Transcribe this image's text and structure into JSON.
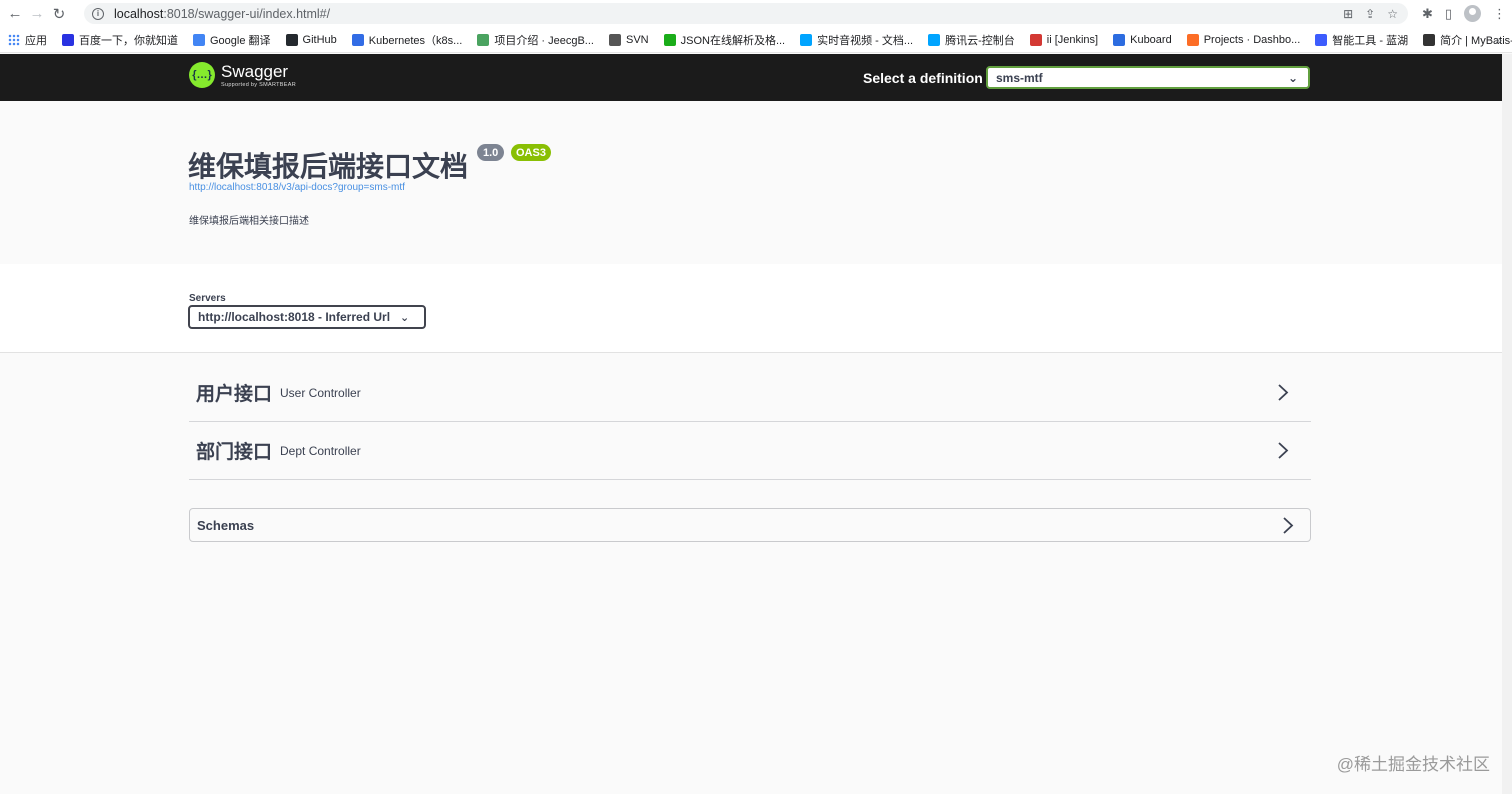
{
  "browser": {
    "url_host": "localhost",
    "url_rest": ":8018/swagger-ui/index.html#/",
    "bookmarks": [
      {
        "label": "应用",
        "color": "#e8453c"
      },
      {
        "label": "百度一下，你就知道",
        "color": "#2932e1"
      },
      {
        "label": "Google 翻译",
        "color": "#4285f4"
      },
      {
        "label": "GitHub",
        "color": "#24292e"
      },
      {
        "label": "Kubernetes（k8s...",
        "color": "#326ce5"
      },
      {
        "label": "项目介绍 · JeecgB...",
        "color": "#4aa360"
      },
      {
        "label": "SVN",
        "color": "#555555"
      },
      {
        "label": "JSON在线解析及格...",
        "color": "#1aad19"
      },
      {
        "label": "实时音视频 - 文档...",
        "color": "#00a4ff"
      },
      {
        "label": "腾讯云-控制台",
        "color": "#00a4ff"
      },
      {
        "label": "ii [Jenkins]",
        "color": "#d33833"
      },
      {
        "label": "Kuboard",
        "color": "#2c6ce0"
      },
      {
        "label": "Projects · Dashbo...",
        "color": "#fc6d26"
      },
      {
        "label": "智能工具 - 蓝湖",
        "color": "#3c5cfd"
      },
      {
        "label": "简介 | MyBatis-Plus",
        "color": "#333333"
      }
    ]
  },
  "topbar": {
    "logo_title": "Swagger",
    "logo_sub": "Supported by SMARTBEAR",
    "definition_label": "Select a definition",
    "definition_value": "sms-mtf"
  },
  "info": {
    "title": "维保填报后端接口文档",
    "version": "1.0",
    "oas": "OAS3",
    "url": "http://localhost:8018/v3/api-docs?group=sms-mtf",
    "description": "维保填报后端相关接口描述"
  },
  "servers": {
    "label": "Servers",
    "value": "http://localhost:8018 - Inferred Url"
  },
  "tags": [
    {
      "name": "用户接口",
      "desc": "User Controller"
    },
    {
      "name": "部门接口",
      "desc": "Dept Controller"
    }
  ],
  "schemas": {
    "title": "Schemas"
  },
  "watermark": "@稀土掘金技术社区",
  "colors": {
    "swagger_green": "#85ea2d",
    "topbar_bg": "#1b1b1b",
    "oas_badge": "#89bf04",
    "link": "#4990e2"
  }
}
